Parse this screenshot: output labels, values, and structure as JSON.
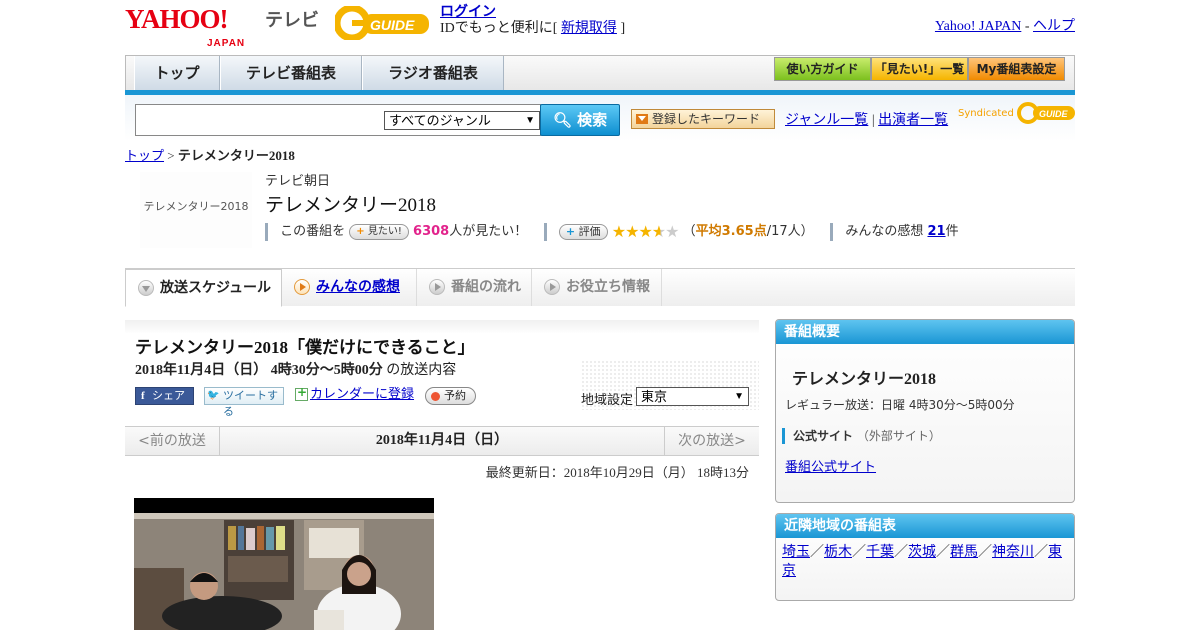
{
  "header": {
    "yahoo_logo": "YAHOO!",
    "yahoo_sub": "JAPAN",
    "terebi": "テレビ",
    "gguide": "G-GUIDE",
    "login": "ログイン",
    "login_desc": "IDでもっと便利に[",
    "register": "新規取得",
    "register_close": "]",
    "yahoo_japan_link": "Yahoo! JAPAN",
    "sep": "-",
    "help_link": "ヘルプ"
  },
  "nav": {
    "tabs": [
      "トップ",
      "テレビ番組表",
      "ラジオ番組表"
    ],
    "buttons": [
      "使い方ガイド",
      "「見たい!」一覧",
      "My番組表設定"
    ]
  },
  "search": {
    "placeholder": "",
    "genre_selected": "すべてのジャンル",
    "search_button": "検索",
    "keyword_button": "登録したキーワード",
    "genre_link": "ジャンル一覧",
    "link_sep": "|",
    "cast_link": "出演者一覧",
    "syndicated": "Syndicated"
  },
  "breadcrumb": {
    "top": "トップ",
    "sep": ">",
    "current": "テレメンタリー2018"
  },
  "program": {
    "thumb_text": "テレメンタリー2018",
    "channel": "テレビ朝日",
    "title": "テレメンタリー2018",
    "watch_prefix": "この番組を",
    "watch_button": "見たい!",
    "watch_count": "6308",
    "watch_suffix": "人が見たい！",
    "rate_button": "評価",
    "rating": 3.65,
    "avg_open": "（",
    "avg_text": "平均3.65点",
    "avg_count": "/17人）",
    "impressions_label": "みんなの感想",
    "impressions_count": "21",
    "impressions_suffix": "件"
  },
  "tabs": [
    {
      "label": "放送スケジュール",
      "state": "active"
    },
    {
      "label": "みんなの感想",
      "state": "link"
    },
    {
      "label": "番組の流れ",
      "state": "disabled"
    },
    {
      "label": "お役立ち情報",
      "state": "disabled"
    }
  ],
  "episode": {
    "title": "テレメンタリー2018「僕だけにできること」",
    "date": "2018年11月4日（日）",
    "time": "4時30分～5時00分",
    "suffix": "の放送内容",
    "share": "シェア",
    "tweet": "ツイートする",
    "calendar": "カレンダーに登録",
    "reserve": "予約",
    "region_label": "地域設定",
    "region_selected": "東京",
    "prev": "<前の放送",
    "nav_date": "2018年11月4日（日）",
    "next": "次の放送>",
    "updated": "最終更新日：2018年10月29日（月） 18時13分"
  },
  "sidebar": {
    "overview_head": "番組概要",
    "title": "テレメンタリー2018",
    "regular": "レギュラー放送：日曜 4時30分～5時00分",
    "official_label": "公式サイト",
    "official_note": "（外部サイト）",
    "official_link": "番組公式サイト",
    "nearby_head": "近隣地域の番組表",
    "nearby": [
      "埼玉",
      "栃木",
      "千葉",
      "茨城",
      "群馬",
      "神奈川",
      "東京"
    ],
    "nearby_sep": "／"
  },
  "colors": {
    "accent_blue": "#1a96d4",
    "pink": "#e2238c",
    "star": "#f5b400",
    "yahoo_red": "#e60012",
    "gguide_yellow": "#f5b400"
  }
}
